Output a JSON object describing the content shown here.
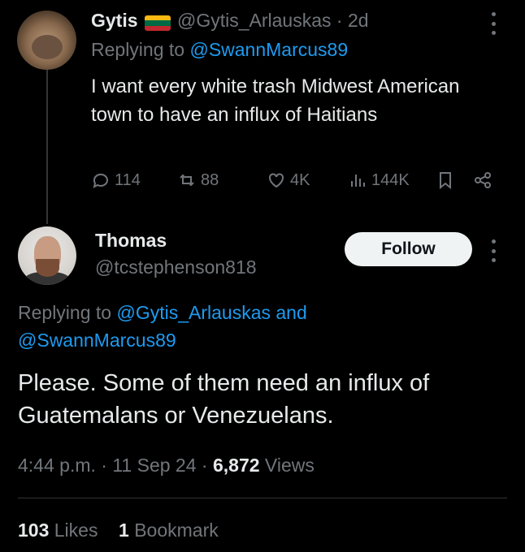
{
  "tweet1": {
    "display_name": "Gytis",
    "handle_time": "@Gytis_Arlauskas · 2d",
    "replying_prefix": "Replying to ",
    "replying_to": "@SwannMarcus89",
    "text": "I want every white trash Midwest American town to have an influx of Haitians",
    "stats": {
      "replies": "114",
      "reposts": "88",
      "likes": "4K",
      "views": "144K"
    },
    "flag_colors": [
      "#fdb913",
      "#006a44",
      "#c1272d"
    ]
  },
  "tweet2": {
    "display_name": "Thomas",
    "handle": "@tcstephenson818",
    "follow_label": "Follow",
    "replying_prefix": "Replying to ",
    "replying_to_1": "@Gytis_Arlauskas",
    "replying_and": " and",
    "replying_to_2": "@SwannMarcus89",
    "text": "Please.  Some of them need an influx of Guatemalans or Venezuelans.",
    "time": "4:44 p.m.",
    "date": "11 Sep 24",
    "separator": " · ",
    "views_count": "6,872",
    "views_label": "Views",
    "likes_count": "103",
    "likes_label": "Likes",
    "bookmarks_count": "1",
    "bookmarks_label": "Bookmark"
  },
  "colors": {
    "background": "#000000",
    "text_primary": "#e7e9ea",
    "text_muted": "#71767b",
    "link": "#1d9bf0",
    "follow_button_bg": "#eff3f4"
  }
}
